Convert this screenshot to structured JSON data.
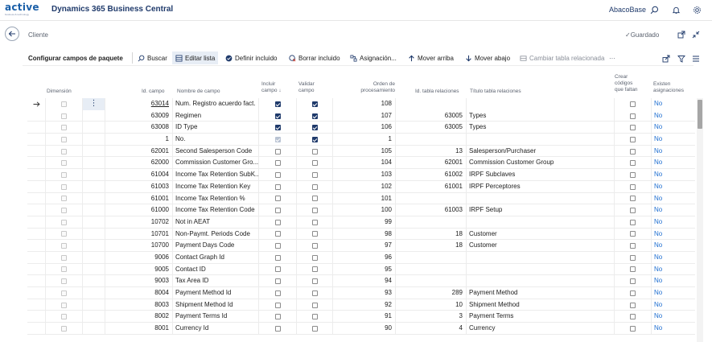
{
  "app": {
    "logo_text": "active",
    "logo_sub": "business & technology",
    "title": "Dynamics 365 Business Central",
    "company": "AbacoBase",
    "icons": [
      "search-icon",
      "bell-icon",
      "gear-icon",
      "help-icon"
    ]
  },
  "page": {
    "caption": "Cliente",
    "saved_label": "Guardado"
  },
  "actions": {
    "title": "Configurar campos de paquete",
    "items": [
      {
        "label": "Buscar",
        "icon": "search-icon"
      },
      {
        "label": "Editar lista",
        "icon": "edit-list-icon"
      },
      {
        "label": "Definir incluido",
        "icon": "check-circle-icon"
      },
      {
        "label": "Borrar incluido",
        "icon": "clear-icon"
      },
      {
        "label": "Asignación...",
        "icon": "mapping-icon"
      },
      {
        "label": "Mover arriba",
        "icon": "arrow-up-icon"
      },
      {
        "label": "Mover abajo",
        "icon": "arrow-down-icon"
      },
      {
        "label": "Cambiar tabla relacionada",
        "icon": "change-table-icon"
      },
      {
        "label": "···",
        "icon": "more-icon"
      }
    ]
  },
  "columns": {
    "dimension": "Dimensión",
    "field_id": "Id. campo",
    "field_name": "Nombre de campo",
    "include": [
      "Incluir",
      "campo ↓"
    ],
    "validate": [
      "Validar",
      "campo"
    ],
    "order": [
      "Orden de",
      "procesamiento"
    ],
    "rel_table_id": "Id. tabla relaciones",
    "rel_table_title": "Título tabla relaciones",
    "create_missing": [
      "Crear",
      "códigos",
      "que faltan"
    ],
    "assignments": [
      "Existen",
      "asignaciones"
    ]
  },
  "rows": [
    {
      "field_id": "63014",
      "name": "Num. Registro acuerdo fact.",
      "include": true,
      "validate": true,
      "order": "108",
      "rel_id": "",
      "rel_title": "",
      "create": false,
      "assign": "No",
      "selected": true
    },
    {
      "field_id": "63009",
      "name": "Regimen",
      "include": true,
      "validate": true,
      "order": "107",
      "rel_id": "63005",
      "rel_title": "Types",
      "create": false,
      "assign": "No"
    },
    {
      "field_id": "63008",
      "name": "ID Type",
      "include": true,
      "validate": true,
      "order": "106",
      "rel_id": "63005",
      "rel_title": "Types",
      "create": false,
      "assign": "No"
    },
    {
      "field_id": "1",
      "name": "No.",
      "include": true,
      "validate": true,
      "order": "1",
      "rel_id": "",
      "rel_title": "",
      "create": false,
      "assign": "No",
      "include_disabled": true
    },
    {
      "field_id": "62001",
      "name": "Second Salesperson Code",
      "include": false,
      "validate": false,
      "order": "105",
      "rel_id": "13",
      "rel_title": "Salesperson/Purchaser",
      "create": false,
      "assign": "No"
    },
    {
      "field_id": "62000",
      "name": "Commission Customer Gro...",
      "include": false,
      "validate": false,
      "order": "104",
      "rel_id": "62001",
      "rel_title": "Commission Customer Group",
      "create": false,
      "assign": "No"
    },
    {
      "field_id": "61004",
      "name": "Income Tax Retention SubK...",
      "include": false,
      "validate": false,
      "order": "103",
      "rel_id": "61002",
      "rel_title": "IRPF Subclaves",
      "create": false,
      "assign": "No"
    },
    {
      "field_id": "61003",
      "name": "Income Tax Retention Key",
      "include": false,
      "validate": false,
      "order": "102",
      "rel_id": "61001",
      "rel_title": "IRPF Perceptores",
      "create": false,
      "assign": "No"
    },
    {
      "field_id": "61001",
      "name": "Income Tax Retention %",
      "include": false,
      "validate": false,
      "order": "101",
      "rel_id": "",
      "rel_title": "",
      "create": false,
      "assign": "No"
    },
    {
      "field_id": "61000",
      "name": "Income Tax Retention Code",
      "include": false,
      "validate": false,
      "order": "100",
      "rel_id": "61003",
      "rel_title": "IRPF Setup",
      "create": false,
      "assign": "No"
    },
    {
      "field_id": "10702",
      "name": "Not in AEAT",
      "include": false,
      "validate": false,
      "order": "99",
      "rel_id": "",
      "rel_title": "",
      "create": false,
      "assign": "No"
    },
    {
      "field_id": "10701",
      "name": "Non-Paymt. Periods Code",
      "include": false,
      "validate": false,
      "order": "98",
      "rel_id": "18",
      "rel_title": "Customer",
      "create": false,
      "assign": "No"
    },
    {
      "field_id": "10700",
      "name": "Payment Days Code",
      "include": false,
      "validate": false,
      "order": "97",
      "rel_id": "18",
      "rel_title": "Customer",
      "create": false,
      "assign": "No"
    },
    {
      "field_id": "9006",
      "name": "Contact Graph Id",
      "include": false,
      "validate": false,
      "order": "96",
      "rel_id": "",
      "rel_title": "",
      "create": false,
      "assign": "No"
    },
    {
      "field_id": "9005",
      "name": "Contact ID",
      "include": false,
      "validate": false,
      "order": "95",
      "rel_id": "",
      "rel_title": "",
      "create": false,
      "assign": "No"
    },
    {
      "field_id": "9003",
      "name": "Tax Area ID",
      "include": false,
      "validate": false,
      "order": "94",
      "rel_id": "",
      "rel_title": "",
      "create": false,
      "assign": "No"
    },
    {
      "field_id": "8004",
      "name": "Payment Method Id",
      "include": false,
      "validate": false,
      "order": "93",
      "rel_id": "289",
      "rel_title": "Payment Method",
      "create": false,
      "assign": "No"
    },
    {
      "field_id": "8003",
      "name": "Shipment Method Id",
      "include": false,
      "validate": false,
      "order": "92",
      "rel_id": "10",
      "rel_title": "Shipment Method",
      "create": false,
      "assign": "No"
    },
    {
      "field_id": "8002",
      "name": "Payment Terms Id",
      "include": false,
      "validate": false,
      "order": "91",
      "rel_id": "3",
      "rel_title": "Payment Terms",
      "create": false,
      "assign": "No"
    },
    {
      "field_id": "8001",
      "name": "Currency Id",
      "include": false,
      "validate": false,
      "order": "90",
      "rel_id": "4",
      "rel_title": "Currency",
      "create": false,
      "assign": "No"
    }
  ],
  "colors": {
    "brand": "#1f3a6b",
    "link": "#1f6fd1",
    "accent_bg": "#e7edf5"
  }
}
